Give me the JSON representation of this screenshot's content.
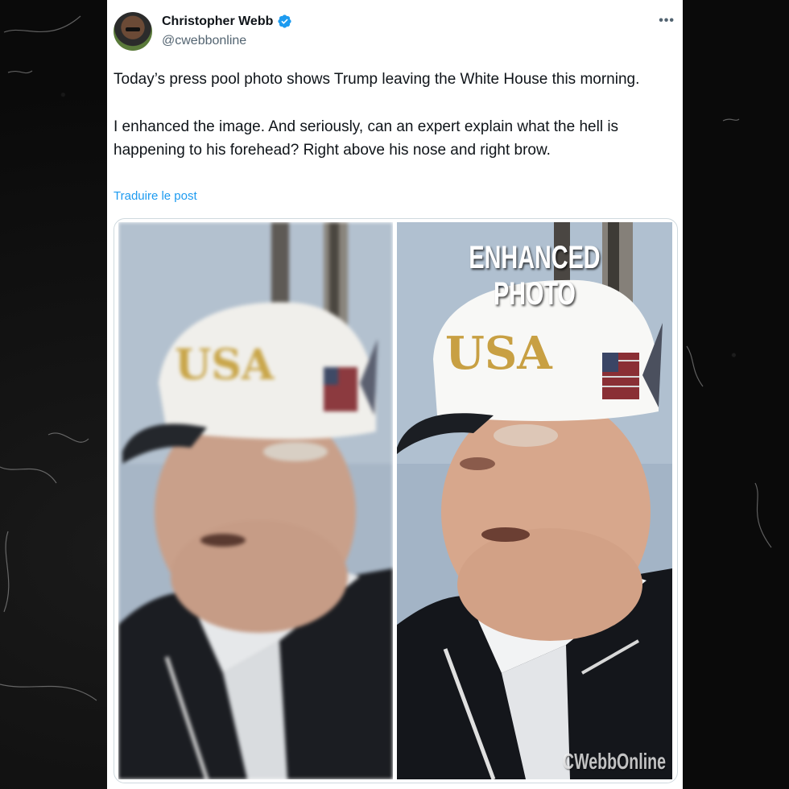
{
  "post": {
    "author_name": "Christopher Webb",
    "author_handle": "@cwebbonline",
    "more_label": "•••",
    "paragraphs": [
      "Today’s press pool photo shows Trump leaving the White House this morning.",
      "I enhanced the image. And  seriously, can an expert explain what the hell is happening to his forehead? Right above his nose and right brow."
    ],
    "translate_label": "Traduire le post"
  },
  "media": {
    "left_cap_text": "USA",
    "right_cap_text": "USA",
    "right_overlay_label": "ENHANCED PHOTO",
    "watermark": "CWebbOnline"
  },
  "colors": {
    "accent": "#1d9bf0",
    "text_primary": "#0f1419",
    "text_secondary": "#536471"
  },
  "icons": {
    "verified": "verified-badge-icon",
    "more": "more-options-icon"
  }
}
